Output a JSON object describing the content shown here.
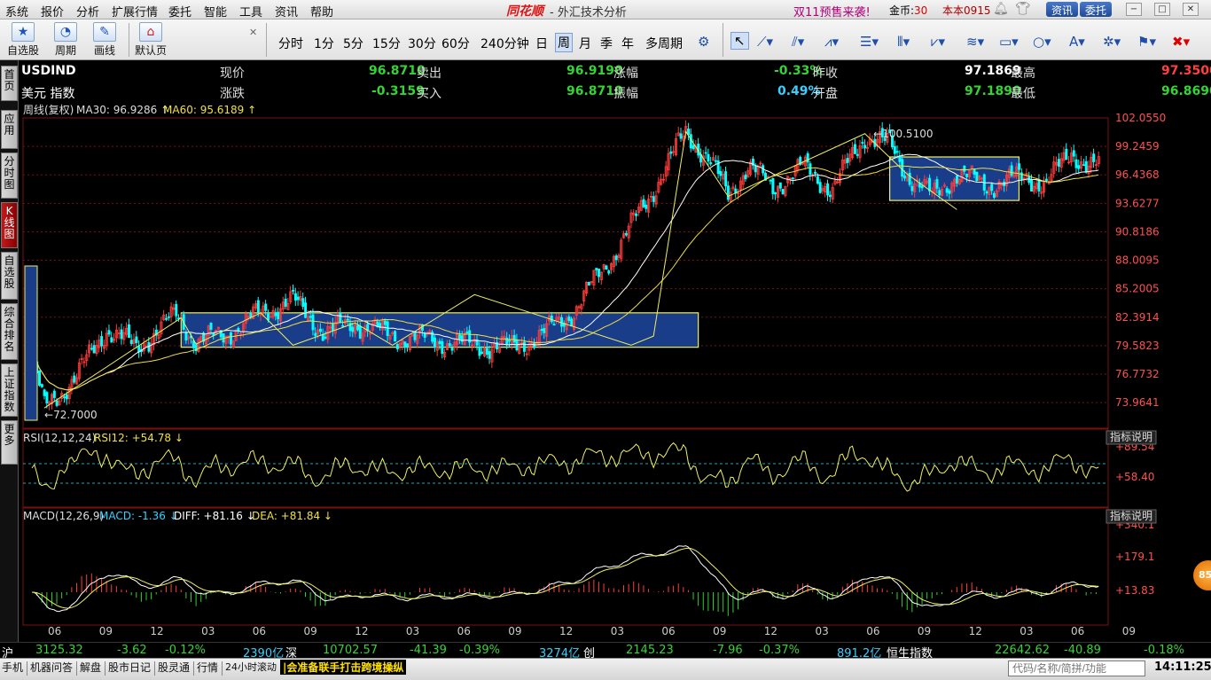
{
  "menu": {
    "items": [
      "系统",
      "报价",
      "分析",
      "扩展行情",
      "委托",
      "智能",
      "工具",
      "资讯",
      "帮助"
    ],
    "logo": "同花顺",
    "title": "- 外汇技术分析",
    "promo": "双11预售来袭!",
    "gold_label": "金币:",
    "gold_value": "30",
    "account": "本本0915",
    "btn_news": "资讯",
    "btn_trade": "委托",
    "win_min": "−",
    "win_max": "□",
    "win_close": "✕"
  },
  "toolbar": {
    "big_buttons": [
      {
        "label": "自选股",
        "icon": "star-icon"
      },
      {
        "label": "周期",
        "icon": "cycle-icon"
      },
      {
        "label": "画线",
        "icon": "pen-icon"
      },
      {
        "label": "默认页",
        "icon": "home-icon"
      }
    ],
    "periods": [
      "分时",
      "1分",
      "5分",
      "15分",
      "30分",
      "60分",
      "240分钟",
      "日",
      "周",
      "月",
      "季",
      "年",
      "多周期"
    ],
    "active_period": "周",
    "tools": [
      {
        "name": "settings-icon",
        "glyph": "⚙"
      },
      {
        "name": "cursor-icon",
        "glyph": "↖"
      },
      {
        "name": "line-icon",
        "glyph": "⟋"
      },
      {
        "name": "parallel-lines-icon",
        "glyph": "⫽"
      },
      {
        "name": "wave-icon",
        "glyph": "⩘"
      },
      {
        "name": "fib-icon",
        "glyph": "☰"
      },
      {
        "name": "bars-icon",
        "glyph": "⦀"
      },
      {
        "name": "channel-icon",
        "glyph": "⩗"
      },
      {
        "name": "band-icon",
        "glyph": "≋"
      },
      {
        "name": "rectangle-icon",
        "glyph": "▭"
      },
      {
        "name": "circle-icon",
        "glyph": "○"
      },
      {
        "name": "text-icon",
        "glyph": "A"
      },
      {
        "name": "gear-icon",
        "glyph": "✲"
      },
      {
        "name": "bookmark-icon",
        "glyph": "⚑"
      },
      {
        "name": "delete-icon",
        "glyph": "✖"
      }
    ]
  },
  "sidebar": [
    "首页",
    "应用",
    "分时图",
    "K线图",
    "自选股",
    "综合排名",
    "上证指数",
    "更多"
  ],
  "quote": {
    "symbol": "USDIND",
    "name": "美元 指数",
    "current_label": "现价",
    "current": "96.8710",
    "change_label": "涨跌",
    "change": "-0.3159",
    "sell_label": "卖出",
    "sell": "96.9190",
    "buy_label": "买入",
    "buy": "96.8710",
    "pct_label": "涨幅",
    "pct": "-0.33%",
    "amp_label": "振幅",
    "amp": "0.49%",
    "prev_label": "昨收",
    "prev": "97.1869",
    "open_label": "开盘",
    "open": "97.1890",
    "high_label": "最高",
    "high": "97.3500",
    "low_label": "最低",
    "low": "96.8690"
  },
  "indicators": {
    "ma_line": "周线(复权)",
    "ma30": "MA30: 96.9286",
    "ma60": "MA60: 95.6189",
    "rsi": "RSI(12,12,24)",
    "rsi12": "RSI12: +54.78",
    "macd": "MACD(12,26,9)",
    "macd_val": "MACD: -1.36",
    "diff": "DIFF: +81.16",
    "dea": "DEA: +81.84",
    "explain": "指标说明"
  },
  "chart_data": {
    "type": "candlestick",
    "price_ticks": [
      "102.0550",
      "99.2459",
      "96.4368",
      "93.6277",
      "90.8186",
      "88.0095",
      "85.2005",
      "82.3914",
      "79.5823",
      "76.7732",
      "73.9641"
    ],
    "price_range": [
      71.4,
      102.055
    ],
    "annotations": [
      "100.5100",
      "72.7000"
    ],
    "rsi_ticks": [
      "+89.54",
      "+58.40"
    ],
    "macd_ticks": [
      "+340.1",
      "+179.1",
      "+13.83"
    ],
    "x_ticks": [
      "06",
      "09",
      "12",
      "03",
      "06",
      "09",
      "12",
      "03",
      "06",
      "09",
      "12",
      "03",
      "06",
      "09",
      "12",
      "03",
      "06",
      "09",
      "12",
      "03",
      "06",
      "09"
    ],
    "ohlc_anchors": [
      [
        0,
        78.5
      ],
      [
        5,
        73.4
      ],
      [
        18,
        76.5
      ],
      [
        30,
        81.2
      ],
      [
        42,
        79.3
      ],
      [
        58,
        82.6
      ],
      [
        66,
        80.0
      ],
      [
        78,
        80.6
      ],
      [
        92,
        82.8
      ],
      [
        105,
        84.0
      ],
      [
        118,
        80.8
      ],
      [
        130,
        81.8
      ],
      [
        145,
        80.5
      ],
      [
        165,
        80.0
      ],
      [
        178,
        79.6
      ],
      [
        193,
        79.4
      ],
      [
        205,
        80.6
      ],
      [
        218,
        83.0
      ],
      [
        235,
        89.0
      ],
      [
        250,
        95.0
      ],
      [
        263,
        100.7
      ],
      [
        272,
        98.0
      ],
      [
        280,
        94.5
      ],
      [
        288,
        97.3
      ],
      [
        298,
        95.2
      ],
      [
        310,
        97.2
      ],
      [
        322,
        95.0
      ],
      [
        335,
        100.3
      ],
      [
        345,
        99.4
      ],
      [
        352,
        96.5
      ],
      [
        362,
        94.3
      ],
      [
        372,
        96.5
      ],
      [
        385,
        95.4
      ],
      [
        400,
        96.3
      ],
      [
        408,
        95.4
      ],
      [
        418,
        98.8
      ],
      [
        425,
        97.2
      ]
    ]
  },
  "status": {
    "sh_label": "沪",
    "sh_price": "3125.32",
    "sh_chg": "-3.62",
    "sh_pct": "-0.12%",
    "sh_vol": "2390亿",
    "sz_label": "深",
    "sz_price": "10702.57",
    "sz_chg": "-41.39",
    "sz_pct": "-0.39%",
    "sz_vol": "3274亿",
    "cy_label": "创",
    "cy_price": "2145.23",
    "cy_chg": "-7.96",
    "cy_pct": "-0.37%",
    "cy_vol": "891.2亿",
    "hs_label": "恒生指数",
    "hs_price": "22642.62",
    "hs_chg": "-40.89",
    "hs_pct": "-0.18%"
  },
  "bottom": {
    "items": [
      "手机",
      "机器问答",
      "解盘",
      "股市日记",
      "股灵通",
      "行情",
      "24小时滚动"
    ],
    "ticker": "|会准备联手打击跨境操纵",
    "search_placeholder": "代码/名称/简拼/功能",
    "clock": "14:11:25",
    "badge": "85"
  },
  "colors": {
    "up": "#ff3c3c",
    "down": "#00ffff",
    "ma": "#ffffff",
    "ma60": "#f0e040",
    "box": "#1a3d8a",
    "grid": "#7a1010"
  }
}
